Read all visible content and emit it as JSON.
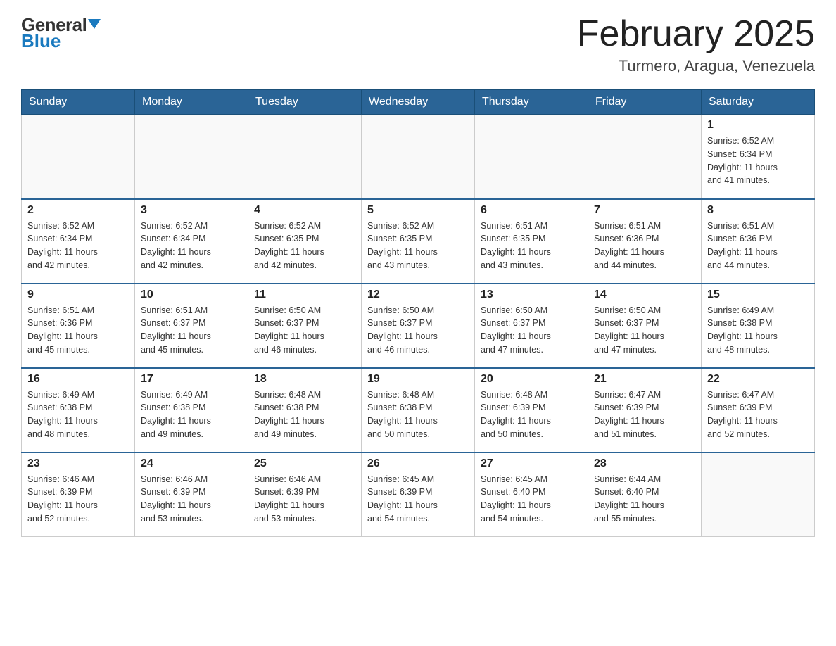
{
  "header": {
    "logo_general": "General",
    "logo_blue": "Blue",
    "month_title": "February 2025",
    "location": "Turmero, Aragua, Venezuela"
  },
  "weekdays": [
    "Sunday",
    "Monday",
    "Tuesday",
    "Wednesday",
    "Thursday",
    "Friday",
    "Saturday"
  ],
  "weeks": [
    [
      {
        "day": "",
        "info": ""
      },
      {
        "day": "",
        "info": ""
      },
      {
        "day": "",
        "info": ""
      },
      {
        "day": "",
        "info": ""
      },
      {
        "day": "",
        "info": ""
      },
      {
        "day": "",
        "info": ""
      },
      {
        "day": "1",
        "info": "Sunrise: 6:52 AM\nSunset: 6:34 PM\nDaylight: 11 hours\nand 41 minutes."
      }
    ],
    [
      {
        "day": "2",
        "info": "Sunrise: 6:52 AM\nSunset: 6:34 PM\nDaylight: 11 hours\nand 42 minutes."
      },
      {
        "day": "3",
        "info": "Sunrise: 6:52 AM\nSunset: 6:34 PM\nDaylight: 11 hours\nand 42 minutes."
      },
      {
        "day": "4",
        "info": "Sunrise: 6:52 AM\nSunset: 6:35 PM\nDaylight: 11 hours\nand 42 minutes."
      },
      {
        "day": "5",
        "info": "Sunrise: 6:52 AM\nSunset: 6:35 PM\nDaylight: 11 hours\nand 43 minutes."
      },
      {
        "day": "6",
        "info": "Sunrise: 6:51 AM\nSunset: 6:35 PM\nDaylight: 11 hours\nand 43 minutes."
      },
      {
        "day": "7",
        "info": "Sunrise: 6:51 AM\nSunset: 6:36 PM\nDaylight: 11 hours\nand 44 minutes."
      },
      {
        "day": "8",
        "info": "Sunrise: 6:51 AM\nSunset: 6:36 PM\nDaylight: 11 hours\nand 44 minutes."
      }
    ],
    [
      {
        "day": "9",
        "info": "Sunrise: 6:51 AM\nSunset: 6:36 PM\nDaylight: 11 hours\nand 45 minutes."
      },
      {
        "day": "10",
        "info": "Sunrise: 6:51 AM\nSunset: 6:37 PM\nDaylight: 11 hours\nand 45 minutes."
      },
      {
        "day": "11",
        "info": "Sunrise: 6:50 AM\nSunset: 6:37 PM\nDaylight: 11 hours\nand 46 minutes."
      },
      {
        "day": "12",
        "info": "Sunrise: 6:50 AM\nSunset: 6:37 PM\nDaylight: 11 hours\nand 46 minutes."
      },
      {
        "day": "13",
        "info": "Sunrise: 6:50 AM\nSunset: 6:37 PM\nDaylight: 11 hours\nand 47 minutes."
      },
      {
        "day": "14",
        "info": "Sunrise: 6:50 AM\nSunset: 6:37 PM\nDaylight: 11 hours\nand 47 minutes."
      },
      {
        "day": "15",
        "info": "Sunrise: 6:49 AM\nSunset: 6:38 PM\nDaylight: 11 hours\nand 48 minutes."
      }
    ],
    [
      {
        "day": "16",
        "info": "Sunrise: 6:49 AM\nSunset: 6:38 PM\nDaylight: 11 hours\nand 48 minutes."
      },
      {
        "day": "17",
        "info": "Sunrise: 6:49 AM\nSunset: 6:38 PM\nDaylight: 11 hours\nand 49 minutes."
      },
      {
        "day": "18",
        "info": "Sunrise: 6:48 AM\nSunset: 6:38 PM\nDaylight: 11 hours\nand 49 minutes."
      },
      {
        "day": "19",
        "info": "Sunrise: 6:48 AM\nSunset: 6:38 PM\nDaylight: 11 hours\nand 50 minutes."
      },
      {
        "day": "20",
        "info": "Sunrise: 6:48 AM\nSunset: 6:39 PM\nDaylight: 11 hours\nand 50 minutes."
      },
      {
        "day": "21",
        "info": "Sunrise: 6:47 AM\nSunset: 6:39 PM\nDaylight: 11 hours\nand 51 minutes."
      },
      {
        "day": "22",
        "info": "Sunrise: 6:47 AM\nSunset: 6:39 PM\nDaylight: 11 hours\nand 52 minutes."
      }
    ],
    [
      {
        "day": "23",
        "info": "Sunrise: 6:46 AM\nSunset: 6:39 PM\nDaylight: 11 hours\nand 52 minutes."
      },
      {
        "day": "24",
        "info": "Sunrise: 6:46 AM\nSunset: 6:39 PM\nDaylight: 11 hours\nand 53 minutes."
      },
      {
        "day": "25",
        "info": "Sunrise: 6:46 AM\nSunset: 6:39 PM\nDaylight: 11 hours\nand 53 minutes."
      },
      {
        "day": "26",
        "info": "Sunrise: 6:45 AM\nSunset: 6:39 PM\nDaylight: 11 hours\nand 54 minutes."
      },
      {
        "day": "27",
        "info": "Sunrise: 6:45 AM\nSunset: 6:40 PM\nDaylight: 11 hours\nand 54 minutes."
      },
      {
        "day": "28",
        "info": "Sunrise: 6:44 AM\nSunset: 6:40 PM\nDaylight: 11 hours\nand 55 minutes."
      },
      {
        "day": "",
        "info": ""
      }
    ]
  ]
}
